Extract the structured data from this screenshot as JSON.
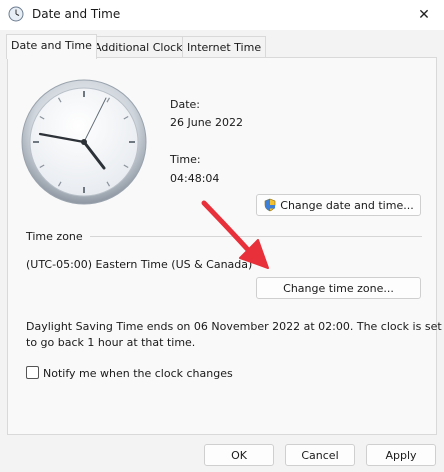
{
  "window": {
    "title": "Date and Time",
    "close_glyph": "✕"
  },
  "tabs": [
    {
      "label": "Date and Time",
      "active": true
    },
    {
      "label": "Additional Clocks",
      "active": false
    },
    {
      "label": "Internet Time",
      "active": false
    }
  ],
  "date": {
    "label": "Date:",
    "value": "26 June 2022"
  },
  "time": {
    "label": "Time:",
    "value": "04:48:04"
  },
  "buttons": {
    "change_date_time": "Change date and time...",
    "change_time_zone": "Change time zone...",
    "ok": "OK",
    "cancel": "Cancel",
    "apply": "Apply"
  },
  "timezone": {
    "section_label": "Time zone",
    "value": "(UTC-05:00) Eastern Time (US & Canada)"
  },
  "dst": {
    "line1": "Daylight Saving Time ends on 06 November 2022 at 02:00. The clock is set",
    "line2": "to go back 1 hour at that time."
  },
  "notify": {
    "label": "Notify me when the clock changes",
    "checked": false
  },
  "colors": {
    "accent": "#0067c0",
    "arrow": "#e8303a"
  }
}
